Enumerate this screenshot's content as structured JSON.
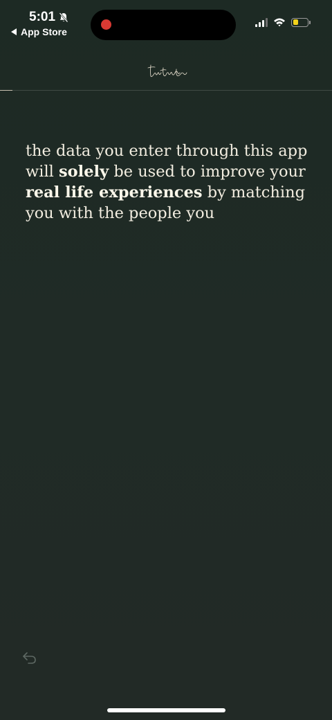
{
  "status_bar": {
    "time": "5:01",
    "back_app": "App Store",
    "icons": [
      "bell-slash-icon",
      "cellular-signal-icon",
      "wifi-icon",
      "battery-icon"
    ],
    "battery_level": 0.35,
    "colors": {
      "battery_fill": "#f2d21b",
      "recording_dot": "#d93a33"
    }
  },
  "header": {
    "logo_text": "twotwotwo",
    "logo_icon": "handwritten-logo-icon"
  },
  "message": {
    "part1": "the data you enter through this app will ",
    "bold1": "solely",
    "part2": " be used to improve your ",
    "bold2": "real life experiences",
    "part3": " by matching you with the people you"
  },
  "footer": {
    "back_icon": "undo-arrow-icon"
  },
  "colors": {
    "background": "#1f2a25",
    "text": "#f2ede0"
  }
}
